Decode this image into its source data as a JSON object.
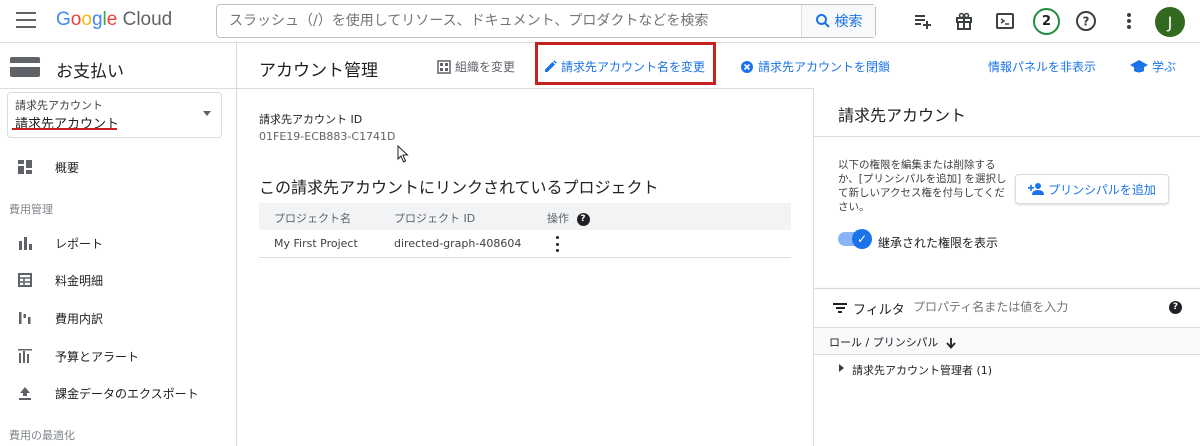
{
  "header": {
    "logo_brand": "Google",
    "logo_product": "Cloud",
    "search_placeholder": "スラッシュ（/）を使用してリソース、ドキュメント、プロダクトなどを検索",
    "search_button": "検索",
    "notification_count": "2",
    "avatar_initial": "J"
  },
  "sidebar": {
    "title": "お支払い",
    "account_select": {
      "label": "請求先アカウント",
      "value": "請求先アカウント"
    },
    "items": [
      {
        "label": "概要",
        "icon": "overview-icon"
      },
      {
        "section": "費用管理"
      },
      {
        "label": "レポート",
        "icon": "bar-chart-icon"
      },
      {
        "label": "料金明細",
        "icon": "table-icon"
      },
      {
        "label": "費用内訳",
        "icon": "cost-breakdown-icon"
      },
      {
        "label": "予算とアラート",
        "icon": "budget-icon"
      },
      {
        "label": "課金データのエクスポート",
        "icon": "upload-icon"
      },
      {
        "section": "費用の最適化"
      }
    ]
  },
  "toolbar": {
    "title": "アカウント管理",
    "change_org": "組織を変更",
    "rename_account": "請求先アカウント名を変更",
    "close_account": "請求先アカウントを閉鎖",
    "hide_info_panel": "情報パネルを非表示",
    "learn": "学ぶ"
  },
  "main": {
    "account_id_label": "請求先アカウント ID",
    "account_id_value": "01FE19-ECB883-C1741D",
    "projects_title": "この請求先アカウントにリンクされているプロジェクト",
    "table": {
      "columns": [
        "プロジェクト名",
        "プロジェクト ID",
        "操作"
      ],
      "rows": [
        {
          "name": "My First Project",
          "id": "directed-graph-408604"
        }
      ]
    }
  },
  "info_panel": {
    "title": "請求先アカウント",
    "description": "以下の権限を編集または削除するか、[プリンシパルを追加] を選択して新しいアクセス権を付与してください。",
    "add_principal": "プリンシパルを追加",
    "show_inherited": "継承された権限を表示",
    "filter_label": "フィルタ",
    "filter_placeholder": "プロパティ名または値を入力",
    "role_column": "ロール / プリンシパル",
    "role_row": "請求先アカウント管理者 (1)"
  },
  "colors": {
    "accent": "#1a73e8",
    "highlight": "#c5221f",
    "avatar": "#33691e",
    "badge_ring": "#1e8e3e"
  }
}
